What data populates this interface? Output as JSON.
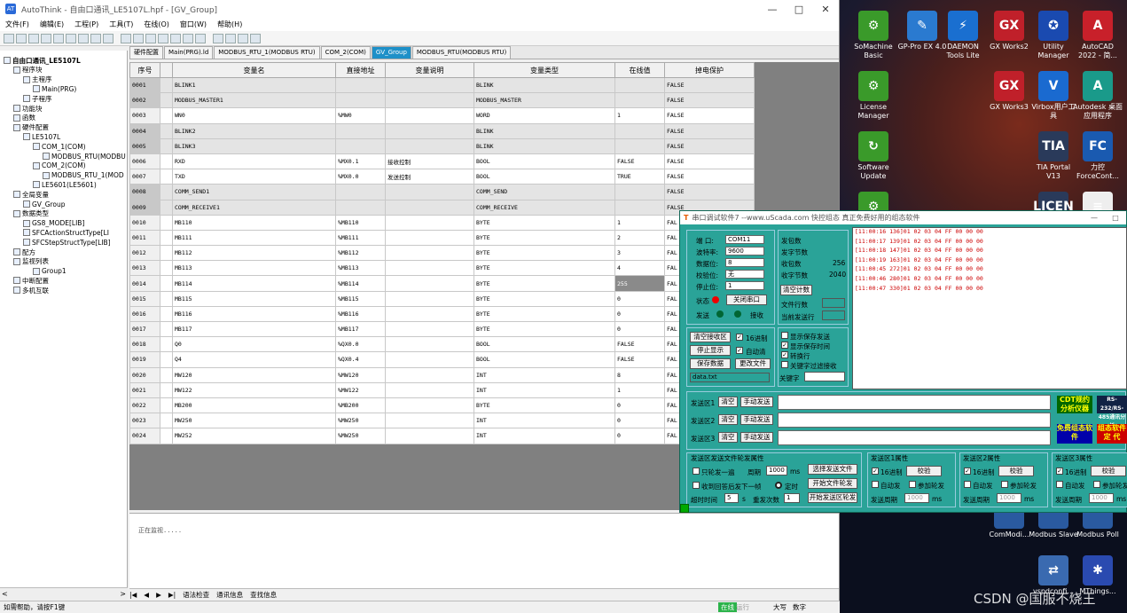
{
  "desktop": {
    "icons": [
      {
        "label": "SoMachine Basic",
        "glyph": "⚙",
        "color": "#3a9a2a"
      },
      {
        "label": "GP-Pro EX 4.0",
        "glyph": "✎",
        "color": "#2a7ad0"
      },
      {
        "label": "DAEMON Tools Lite",
        "glyph": "⚡",
        "color": "#1a6fd0"
      },
      {
        "label": "GX Works2",
        "glyph": "GX",
        "color": "#c0202a"
      },
      {
        "label": "Utility Manager",
        "glyph": "✪",
        "color": "#1a4ab0"
      },
      {
        "label": "AutoCAD 2022 - 简...",
        "glyph": "A",
        "color": "#c8202a"
      },
      {
        "label": "License Manager",
        "glyph": "⚙",
        "color": "#3a9a2a"
      },
      {
        "label": "GX Works3",
        "glyph": "GX",
        "color": "#c0202a"
      },
      {
        "label": "Virbox用户工具",
        "glyph": "V",
        "color": "#1a6ad0"
      },
      {
        "label": "Autodesk 桌面应用程序",
        "glyph": "A",
        "color": "#1a9a8a"
      },
      {
        "label": "Software Update",
        "glyph": "↻",
        "color": "#3a9a2a"
      },
      {
        "label": "TIA Portal V13",
        "glyph": "TIA",
        "color": "#2a3a5a"
      },
      {
        "label": "力控 ForceCont...",
        "glyph": "FC",
        "color": "#1a5ab0"
      },
      {
        "label": "",
        "glyph": "⚙",
        "color": "#3a9a2a"
      },
      {
        "label": "",
        "glyph": "LICEN",
        "color": "#2a3a5a"
      },
      {
        "label": "",
        "glyph": "≡",
        "color": "#eeeeee"
      },
      {
        "label": "ComModi...",
        "glyph": "",
        "color": "#2a5aa0"
      },
      {
        "label": "Modbus Slave",
        "glyph": "",
        "color": "#2a5aa0"
      },
      {
        "label": "Modbus Poll",
        "glyph": "",
        "color": "#2a5aa0"
      },
      {
        "label": "vspdconfi...",
        "glyph": "⇄",
        "color": "#3a6ab0"
      },
      {
        "label": "MThings...",
        "glyph": "✱",
        "color": "#2a4ab0"
      }
    ],
    "watermark": "CSDN @国服不烧王"
  },
  "app": {
    "title": "AutoThink - 自由口通讯_LE5107L.hpf - [GV_Group]",
    "logo": "AT",
    "window_controls": [
      "—",
      "□",
      "✕"
    ],
    "menu": [
      "文件(F)",
      "编辑(E)",
      "工程(P)",
      "工具(T)",
      "在线(O)",
      "窗口(W)",
      "帮助(H)"
    ],
    "toolbar_icons": [
      "new-icon",
      "open-icon",
      "save-icon",
      "print-icon",
      "cut-icon",
      "copy-icon",
      "paste-icon",
      "undo-icon",
      "redo-icon",
      "compile-icon",
      "download-icon",
      "run-icon",
      "stop-icon",
      "online-icon",
      "offline-icon",
      "step-icon",
      "monitor-icon",
      "force-icon",
      "settings-icon",
      "window-icon"
    ],
    "tree": [
      {
        "label": "自由口通讯_LE5107L",
        "indent": 0,
        "bold": true
      },
      {
        "label": "程序块",
        "indent": 1
      },
      {
        "label": "主程序",
        "indent": 2
      },
      {
        "label": "Main(PRG)",
        "indent": 3
      },
      {
        "label": "子程序",
        "indent": 2
      },
      {
        "label": "功能块",
        "indent": 1
      },
      {
        "label": "函数",
        "indent": 1
      },
      {
        "label": "硬件配置",
        "indent": 1
      },
      {
        "label": "LE5107L",
        "indent": 2
      },
      {
        "label": "COM_1(COM)",
        "indent": 3
      },
      {
        "label": "MODBUS_RTU(MODBU",
        "indent": 4
      },
      {
        "label": "COM_2(COM)",
        "indent": 3
      },
      {
        "label": "MODBUS_RTU_1(MOD",
        "indent": 4
      },
      {
        "label": "LE5601(LE5601)",
        "indent": 3
      },
      {
        "label": "全局变量",
        "indent": 1
      },
      {
        "label": "GV_Group",
        "indent": 2
      },
      {
        "label": "数据类型",
        "indent": 1
      },
      {
        "label": "GS8_MODE[LIB]",
        "indent": 2
      },
      {
        "label": "SFCActionStructType[LI",
        "indent": 2
      },
      {
        "label": "SFCStepStructType[LIB]",
        "indent": 2
      },
      {
        "label": "配方",
        "indent": 1
      },
      {
        "label": "监视列表",
        "indent": 1
      },
      {
        "label": "Group1",
        "indent": 3
      },
      {
        "label": "中断配置",
        "indent": 1
      },
      {
        "label": "多机互联",
        "indent": 1
      }
    ],
    "tree_scroll": [
      "<",
      ">"
    ],
    "tabs": [
      {
        "label": "硬件配置",
        "active": false
      },
      {
        "label": "Main(PRG).ld",
        "active": false
      },
      {
        "label": "MODBUS_RTU_1(MODBUS RTU)",
        "active": false
      },
      {
        "label": "COM_2(COM)",
        "active": false
      },
      {
        "label": "GV_Group",
        "active": true
      },
      {
        "label": "MODBUS_RTU(MODBUS RTU)",
        "active": false
      }
    ],
    "grid_headers": [
      "序号",
      "",
      "变量名",
      "直接地址",
      "变量说明",
      "变量类型",
      "在线值",
      "掉电保护"
    ],
    "grid_rows": [
      {
        "no": "0001",
        "name": "BLINK1",
        "addr": "",
        "desc": "",
        "type": "BLINK",
        "val": "",
        "retain": "FALSE",
        "gray": true
      },
      {
        "no": "0002",
        "name": "MODBUS_MASTER1",
        "addr": "",
        "desc": "",
        "type": "MODBUS_MASTER",
        "val": "",
        "retain": "FALSE",
        "gray": true
      },
      {
        "no": "0003",
        "name": "WN0",
        "addr": "%MW0",
        "desc": "",
        "type": "WORD",
        "val": "1",
        "retain": "FALSE",
        "gray": false
      },
      {
        "no": "0004",
        "name": "BLINK2",
        "addr": "",
        "desc": "",
        "type": "BLINK",
        "val": "",
        "retain": "FALSE",
        "gray": true
      },
      {
        "no": "0005",
        "name": "BLINK3",
        "addr": "",
        "desc": "",
        "type": "BLINK",
        "val": "",
        "retain": "FALSE",
        "gray": true
      },
      {
        "no": "0006",
        "name": "RXD",
        "addr": "%MX0.1",
        "desc": "接收控制",
        "type": "BOOL",
        "val": "FALSE",
        "retain": "FALSE",
        "gray": false
      },
      {
        "no": "0007",
        "name": "TXD",
        "addr": "%MX0.0",
        "desc": "发送控制",
        "type": "BOOL",
        "val": "TRUE",
        "retain": "FALSE",
        "gray": false
      },
      {
        "no": "0008",
        "name": "COMM_SEND1",
        "addr": "",
        "desc": "",
        "type": "COMM_SEND",
        "val": "",
        "retain": "FALSE",
        "gray": true
      },
      {
        "no": "0009",
        "name": "COMM_RECEIVE1",
        "addr": "",
        "desc": "",
        "type": "COMM_RECEIVE",
        "val": "",
        "retain": "FALSE",
        "gray": true
      },
      {
        "no": "0010",
        "name": "MB110",
        "addr": "%MB110",
        "desc": "",
        "type": "BYTE",
        "val": "1",
        "retain": "FAL",
        "gray": false
      },
      {
        "no": "0011",
        "name": "MB111",
        "addr": "%MB111",
        "desc": "",
        "type": "BYTE",
        "val": "2",
        "retain": "FAL",
        "gray": false
      },
      {
        "no": "0012",
        "name": "MB112",
        "addr": "%MB112",
        "desc": "",
        "type": "BYTE",
        "val": "3",
        "retain": "FAL",
        "gray": false
      },
      {
        "no": "0013",
        "name": "MB113",
        "addr": "%MB113",
        "desc": "",
        "type": "BYTE",
        "val": "4",
        "retain": "FAL",
        "gray": false
      },
      {
        "no": "0014",
        "name": "MB114",
        "addr": "%MB114",
        "desc": "",
        "type": "BYTE",
        "val": "255",
        "retain": "FAL",
        "gray": false,
        "hl": true
      },
      {
        "no": "0015",
        "name": "MB115",
        "addr": "%MB115",
        "desc": "",
        "type": "BYTE",
        "val": "0",
        "retain": "FAL",
        "gray": false
      },
      {
        "no": "0016",
        "name": "MB116",
        "addr": "%MB116",
        "desc": "",
        "type": "BYTE",
        "val": "0",
        "retain": "FAL",
        "gray": false
      },
      {
        "no": "0017",
        "name": "MB117",
        "addr": "%MB117",
        "desc": "",
        "type": "BYTE",
        "val": "0",
        "retain": "FAL",
        "gray": false
      },
      {
        "no": "0018",
        "name": "Q0",
        "addr": "%QX0.0",
        "desc": "",
        "type": "BOOL",
        "val": "FALSE",
        "retain": "FAL",
        "gray": false
      },
      {
        "no": "0019",
        "name": "Q4",
        "addr": "%QX0.4",
        "desc": "",
        "type": "BOOL",
        "val": "FALSE",
        "retain": "FAL",
        "gray": false
      },
      {
        "no": "0020",
        "name": "MW120",
        "addr": "%MW120",
        "desc": "",
        "type": "INT",
        "val": "8",
        "retain": "FAL",
        "gray": false
      },
      {
        "no": "0021",
        "name": "MW122",
        "addr": "%MW122",
        "desc": "",
        "type": "INT",
        "val": "1",
        "retain": "FAL",
        "gray": false
      },
      {
        "no": "0022",
        "name": "MB200",
        "addr": "%MB200",
        "desc": "",
        "type": "BYTE",
        "val": "0",
        "retain": "FAL",
        "gray": false
      },
      {
        "no": "0023",
        "name": "MW250",
        "addr": "%MW250",
        "desc": "",
        "type": "INT",
        "val": "0",
        "retain": "FAL",
        "gray": false
      },
      {
        "no": "0024",
        "name": "MW252",
        "addr": "%MW250",
        "desc": "",
        "type": "INT",
        "val": "0",
        "retain": "FAL",
        "gray": false
      }
    ],
    "output_msg": "正在监视.....",
    "output_tabs": [
      "|◀",
      "◀",
      "▶",
      "▶|",
      "语法检查",
      "通讯信息",
      "查找信息"
    ],
    "status": {
      "help": "如需帮助，请按F1键",
      "online": "在线",
      "run": "运行",
      "caps": "大写",
      "num": "数字"
    }
  },
  "serial": {
    "title": "串口调试软件7  --www.uScada.com  快控组态 真正免费好用的组态软件",
    "title_logo": "T",
    "window_controls": [
      "—",
      "□"
    ],
    "port_label": "端  口:",
    "port": "COM11",
    "baud_label": "波特率:",
    "baud": "9600",
    "data_label": "数据位:",
    "data_bits": "8",
    "parity_label": "校验位:",
    "parity": "无",
    "stop_label": "停止位:",
    "stop_bits": "1",
    "state_label": "状态",
    "close_port": "关闭串口",
    "send_label": "发送",
    "recv_label": "接收",
    "stats": {
      "send_count": "发包数",
      "send_bytes": "发字节数",
      "recv_count": "收包数",
      "recv_count_val": "256",
      "recv_bytes": "收字节数",
      "recv_bytes_val": "2040"
    },
    "clear_count": "清空计数",
    "file_rows": "文件行数",
    "cur_send_row": "当前发送行",
    "recv_lines": [
      "[11:00:16 136]01 02 03 04 FF 00 00 00",
      "[11:00:17 139]01 02 03 04 FF 00 00 00",
      "[11:00:18 147]01 02 03 04 FF 00 00 00",
      "[11:00:19 163]01 02 03 04 FF 00 00 00",
      "[11:00:45 272]01 02 03 04 FF 00 00 00",
      "[11:00:46 280]01 02 03 04 FF 00 00 00",
      "[11:00:47 330]01 02 03 04 FF 00 00 00"
    ],
    "clear_recv": "清空接收区",
    "stop_show": "停止显示",
    "save_data": "保存数据",
    "hex": "16进制",
    "auto_clear": "自动清",
    "change_file": "更改文件",
    "file_name": "data.txt",
    "show_save_send": "显示保存发送",
    "show_save_time": "显示保存时间",
    "line_wrap": "转换行",
    "kw_filter": "关键字过滤接收",
    "keyword": "关键字",
    "send_areas": [
      "发送区1",
      "发送区2",
      "发送区3"
    ],
    "clear": "清空",
    "manual_send": "手动发送",
    "ads": [
      "CDT规约分析仪器",
      "RS-232/RS-485通讯分析",
      "免费组态软件",
      "组态软件定 代"
    ],
    "file_poll_title": "发送区发送文件轮发属性",
    "once": "只轮发一遍",
    "period": "周期",
    "period_val": "1000",
    "ms": "ms",
    "choose_file": "选择发送文件",
    "start_file_poll": "开始文件轮发",
    "recv_reply": "收到回答后发下一帧",
    "timer": "定时",
    "timeout": "超时时间",
    "timeout_val": "5",
    "s": "s",
    "resend": "重发次数",
    "resend_val": "1",
    "start_area_poll": "开始发送区轮发",
    "area_props": [
      {
        "title": "发送区1属性",
        "hex": "16进制",
        "check": "校验",
        "auto": "自动发",
        "add_poll": "参加轮发",
        "cycle": "发送周期",
        "cycle_val": "1000",
        "ms": "ms"
      },
      {
        "title": "发送区2属性",
        "hex": "16进制",
        "check": "校验",
        "auto": "自动发",
        "add_poll": "参加轮发",
        "cycle": "发送周期",
        "cycle_val": "1000",
        "ms": "ms"
      },
      {
        "title": "发送区3属性",
        "hex": "16进制",
        "check": "校验",
        "auto": "自动发",
        "add_poll": "参加轮发",
        "cycle": "发送周期",
        "cycle_val": "1000",
        "ms": "ms"
      }
    ]
  }
}
